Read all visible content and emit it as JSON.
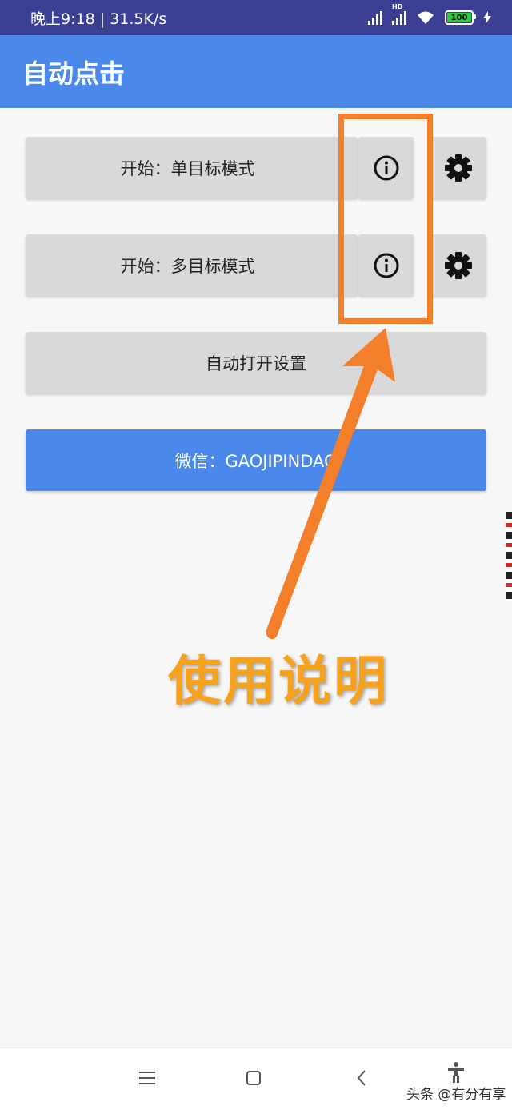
{
  "status_bar": {
    "time_speed": "晚上9:18 | 31.5K/s",
    "hd_label": "HD",
    "battery": "100",
    "battery_level": 1.0,
    "battery_color": "#2ecc40"
  },
  "app_bar": {
    "title": "自动点击",
    "color": "#4a88ea"
  },
  "main": {
    "single_mode_label": "开始：单目标模式",
    "multi_mode_label": "开始：多目标模式",
    "auto_open_settings_label": "自动打开设置",
    "wechat_label": "微信：GAOJIPINDAO",
    "info_icon": "info-icon",
    "settings_icon": "gear-icon"
  },
  "annotation": {
    "callout_text": "使用说明",
    "highlight_color": "#f47f2a",
    "text_color": "#f7a21d"
  },
  "nav_bar": {
    "items": [
      "menu-icon",
      "home-icon",
      "back-icon",
      "accessibility-icon"
    ]
  },
  "watermark": "头条 @有分有享"
}
